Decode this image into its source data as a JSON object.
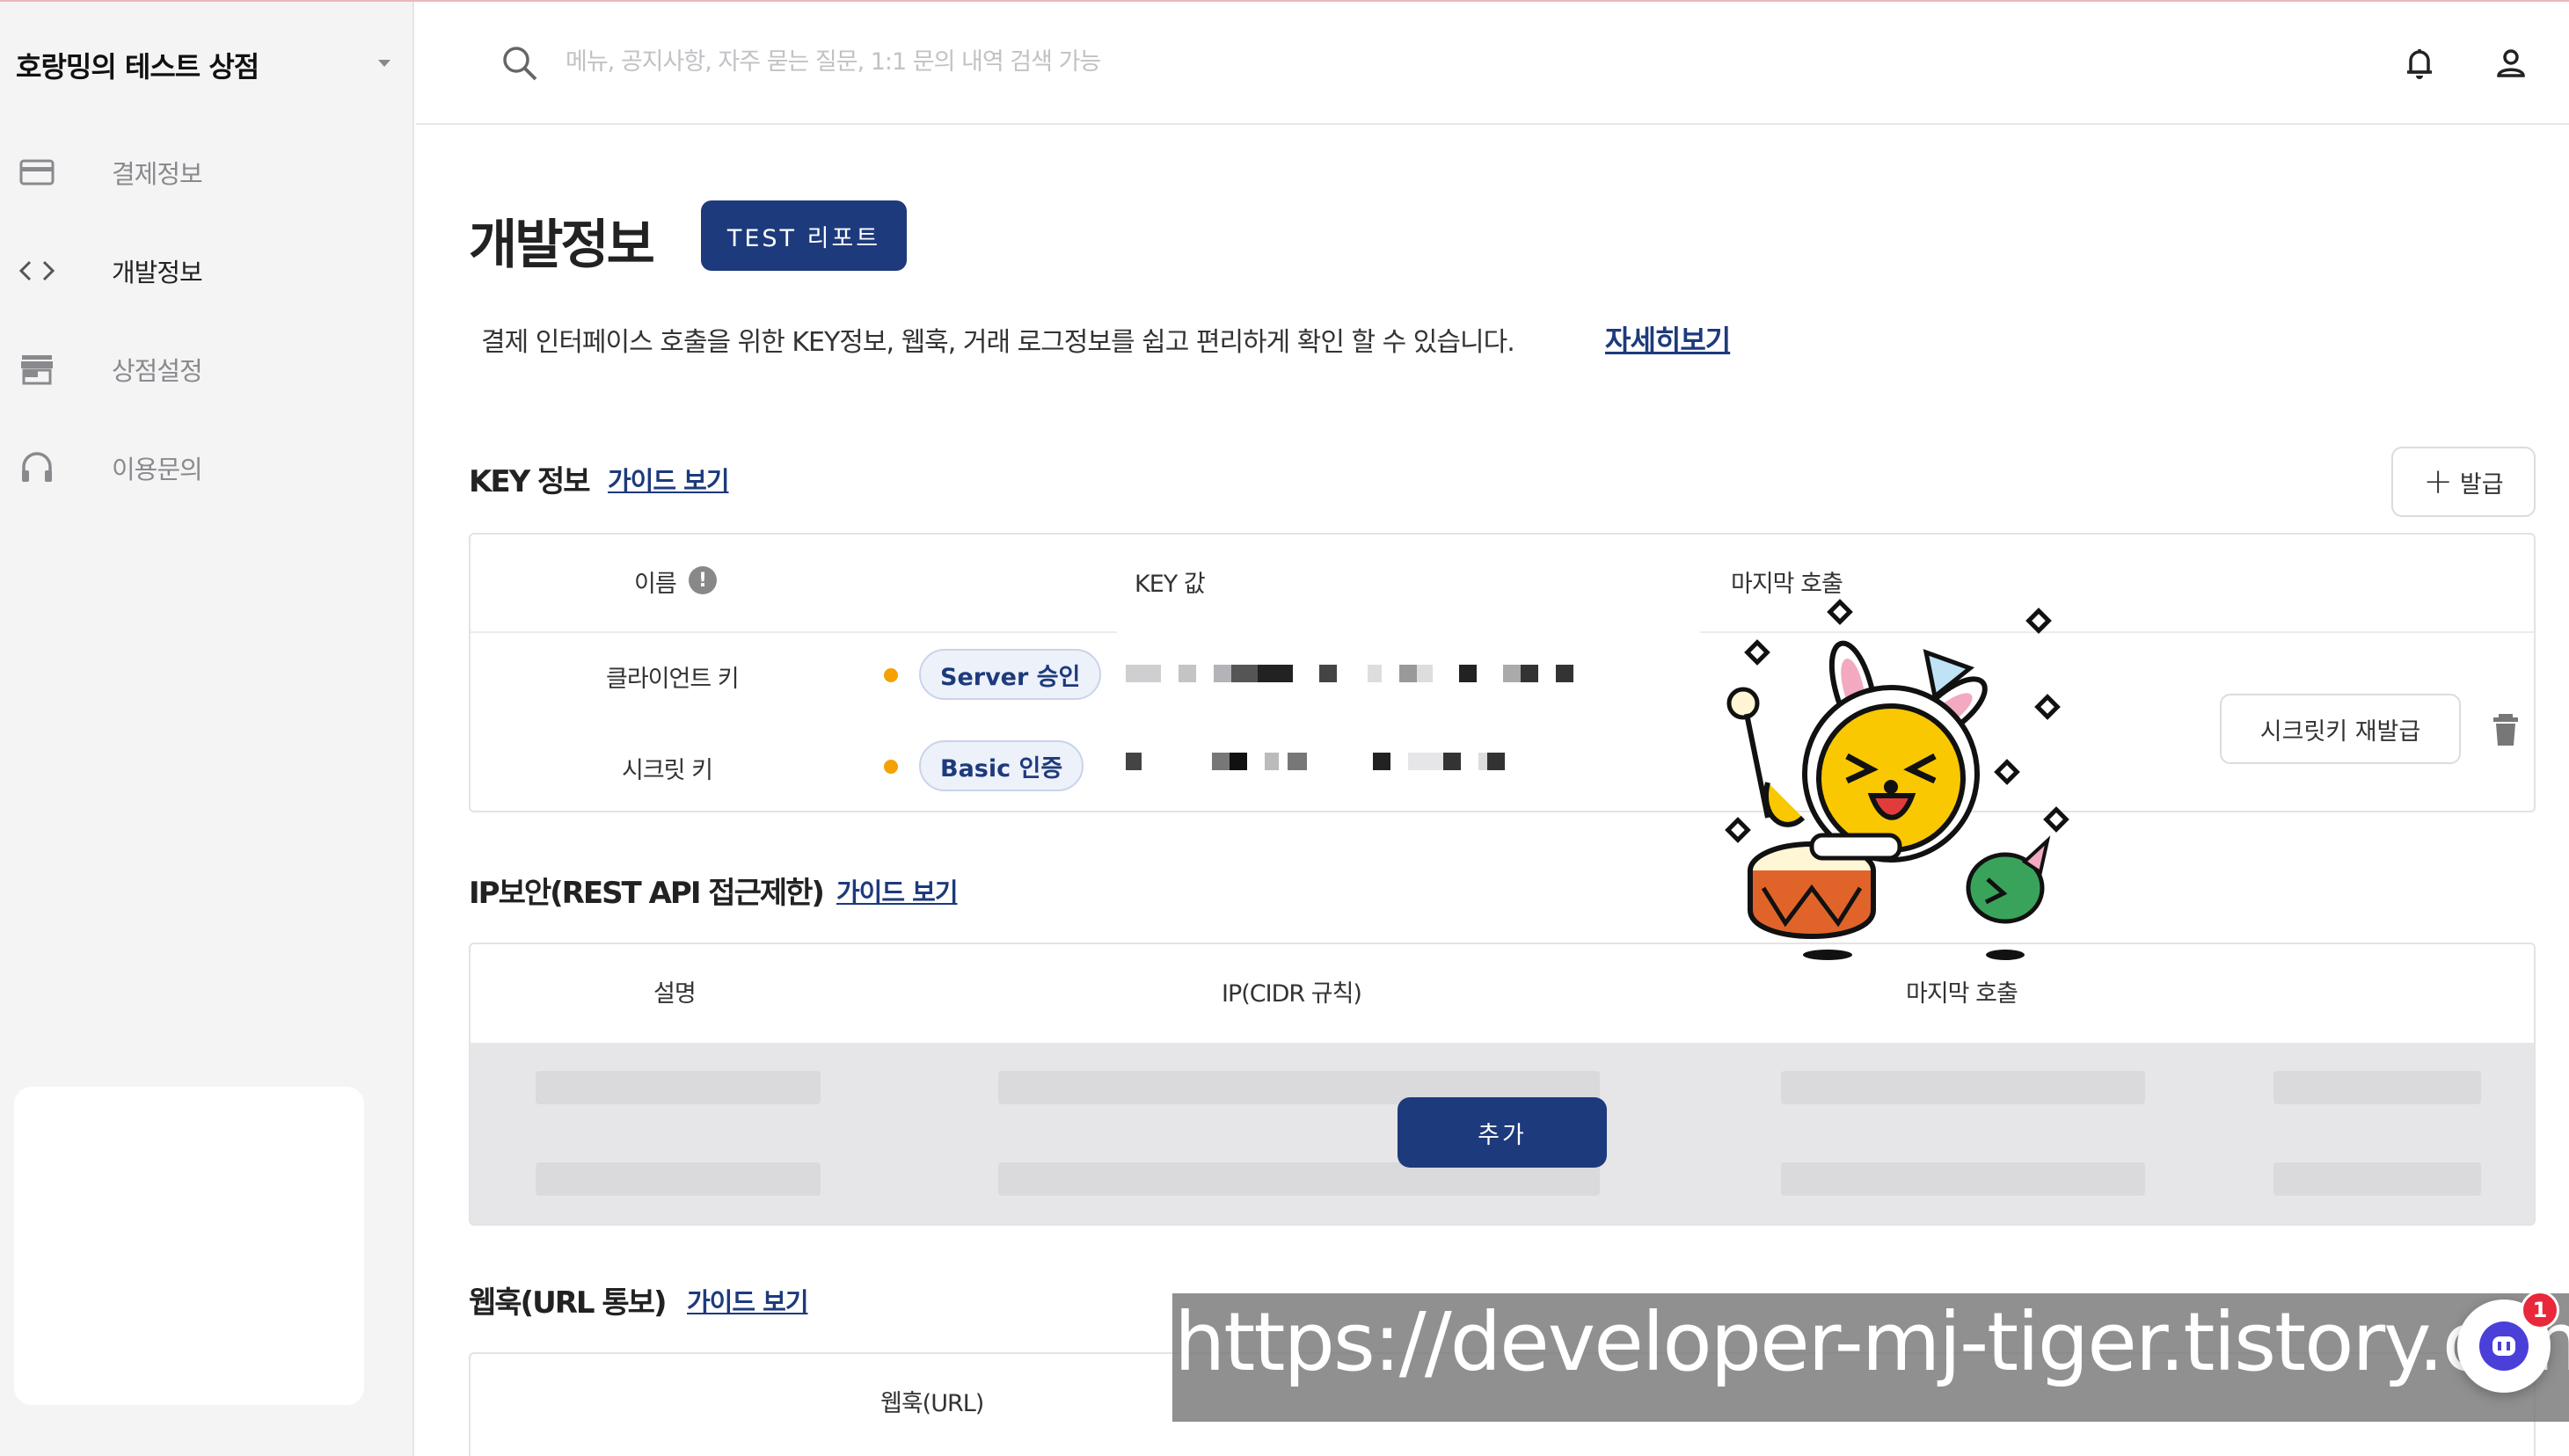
{
  "sidebar": {
    "store_name": "호랑밍의 테스트 상점",
    "items": [
      {
        "label": "결제정보",
        "icon": "card-icon"
      },
      {
        "label": "개발정보",
        "icon": "code-icon"
      },
      {
        "label": "상점설정",
        "icon": "store-icon"
      },
      {
        "label": "이용문의",
        "icon": "headset-icon"
      }
    ],
    "active_item": "개발정보"
  },
  "header": {
    "search_placeholder": "메뉴, 공지사항, 자주 묻는 질문, 1:1 문의 내역 검색 가능",
    "icons": [
      "search-icon",
      "bell-icon",
      "user-icon"
    ]
  },
  "page": {
    "title": "개발정보",
    "test_report_label": "TEST 리포트",
    "description": "결제 인터페이스 호출을 위한 KEY정보, 웹훅, 거래 로그정보를 쉽고 편리하게 확인 할 수 있습니다.",
    "more_link": "자세히보기"
  },
  "key_section": {
    "title": "KEY 정보",
    "guide": "가이드 보기",
    "issue_button": "발급",
    "columns": {
      "name": "이름",
      "key": "KEY 값",
      "last_call": "마지막 호출"
    },
    "rows": [
      {
        "name": "클라이언트 키",
        "badge": "Server 승인"
      },
      {
        "name": "시크릿 키",
        "badge": "Basic 인증"
      }
    ],
    "secret_reissue_button": "시크릿키 재발급"
  },
  "ip_section": {
    "title": "IP보안(REST API 접근제한)",
    "guide": "가이드 보기",
    "columns": {
      "desc": "설명",
      "ip": "IP(CIDR 규칙)",
      "last_call": "마지막 호출"
    },
    "add_button": "추가"
  },
  "webhook_section": {
    "title": "웹훅(URL 통보)",
    "guide": "가이드 보기",
    "columns": {
      "url": "웹훅(URL)"
    }
  },
  "watermark": "https://developer-mj-tiger.tistory.com",
  "chat": {
    "badge_count": "1"
  },
  "colors": {
    "accent": "#1d3a7c",
    "status_dot": "#f5a100",
    "sidebar_bg": "#f4f4f5",
    "badge_red": "#e9283b"
  }
}
